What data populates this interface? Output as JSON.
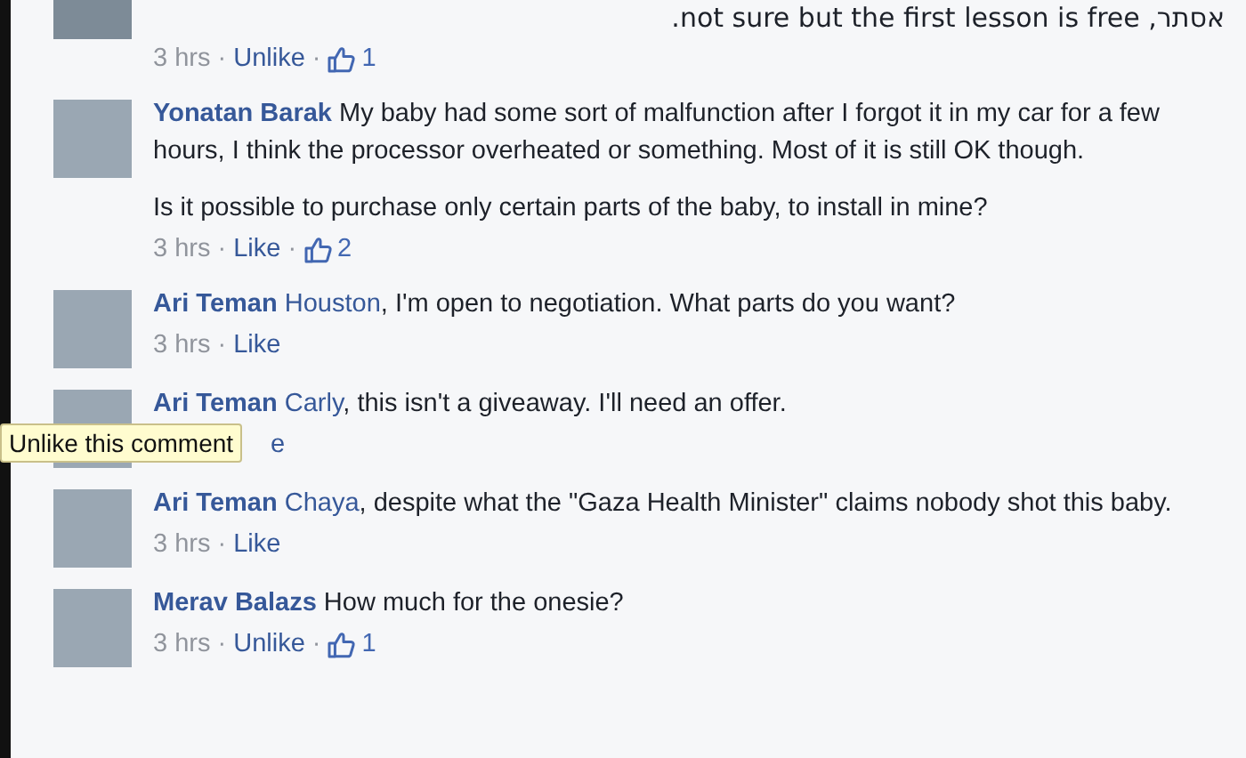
{
  "comments": [
    {
      "avatar_cut": true,
      "rtl": true,
      "paragraphs": [
        "אסתר, not sure but the first lesson is free."
      ],
      "meta": [
        {
          "kind": "time",
          "text": "3 hrs"
        },
        {
          "kind": "sep",
          "text": "·"
        },
        {
          "kind": "action",
          "text": "Unlike"
        },
        {
          "kind": "sep",
          "text": "·"
        },
        {
          "kind": "likes",
          "text": "1"
        }
      ]
    },
    {
      "author": "Yonatan Barak",
      "paragraphs": [
        "My baby had some sort of malfunction after I forgot it in my car for a few hours, I think the processor overheated or something. Most of it is still OK though.",
        "Is it possible to purchase only certain parts of the baby, to install in mine?"
      ],
      "meta": [
        {
          "kind": "time",
          "text": "3 hrs"
        },
        {
          "kind": "sep",
          "text": "·"
        },
        {
          "kind": "action",
          "text": "Like"
        },
        {
          "kind": "sep",
          "text": "·"
        },
        {
          "kind": "likes",
          "text": "2"
        }
      ]
    },
    {
      "author": "Ari Teman",
      "mention": "Houston",
      "paragraphs": [
        ", I'm open to negotiation. What parts do you want?"
      ],
      "meta": [
        {
          "kind": "time",
          "text": "3 hrs"
        },
        {
          "kind": "sep",
          "text": "·"
        },
        {
          "kind": "action",
          "text": "Like"
        }
      ]
    },
    {
      "author": "Ari Teman",
      "mention": "Carly",
      "paragraphs": [
        ", this isn't a giveaway. I'll need an offer."
      ],
      "meta": [
        {
          "kind": "action",
          "text": "e"
        }
      ],
      "tooltip": "Unlike this comment"
    },
    {
      "author": "Ari Teman",
      "mention": "Chaya",
      "paragraphs": [
        ", despite what the \"Gaza Health Minister\" claims nobody shot this baby."
      ],
      "meta": [
        {
          "kind": "time",
          "text": "3 hrs"
        },
        {
          "kind": "sep",
          "text": "·"
        },
        {
          "kind": "action",
          "text": "Like"
        }
      ]
    },
    {
      "author": "Merav Balazs",
      "paragraphs": [
        "How much for the onesie?"
      ],
      "meta": [
        {
          "kind": "time",
          "text": "3 hrs"
        },
        {
          "kind": "sep",
          "text": "·"
        },
        {
          "kind": "action",
          "text": "Unlike"
        },
        {
          "kind": "sep",
          "text": "·"
        },
        {
          "kind": "likes",
          "text": "1"
        }
      ]
    }
  ]
}
